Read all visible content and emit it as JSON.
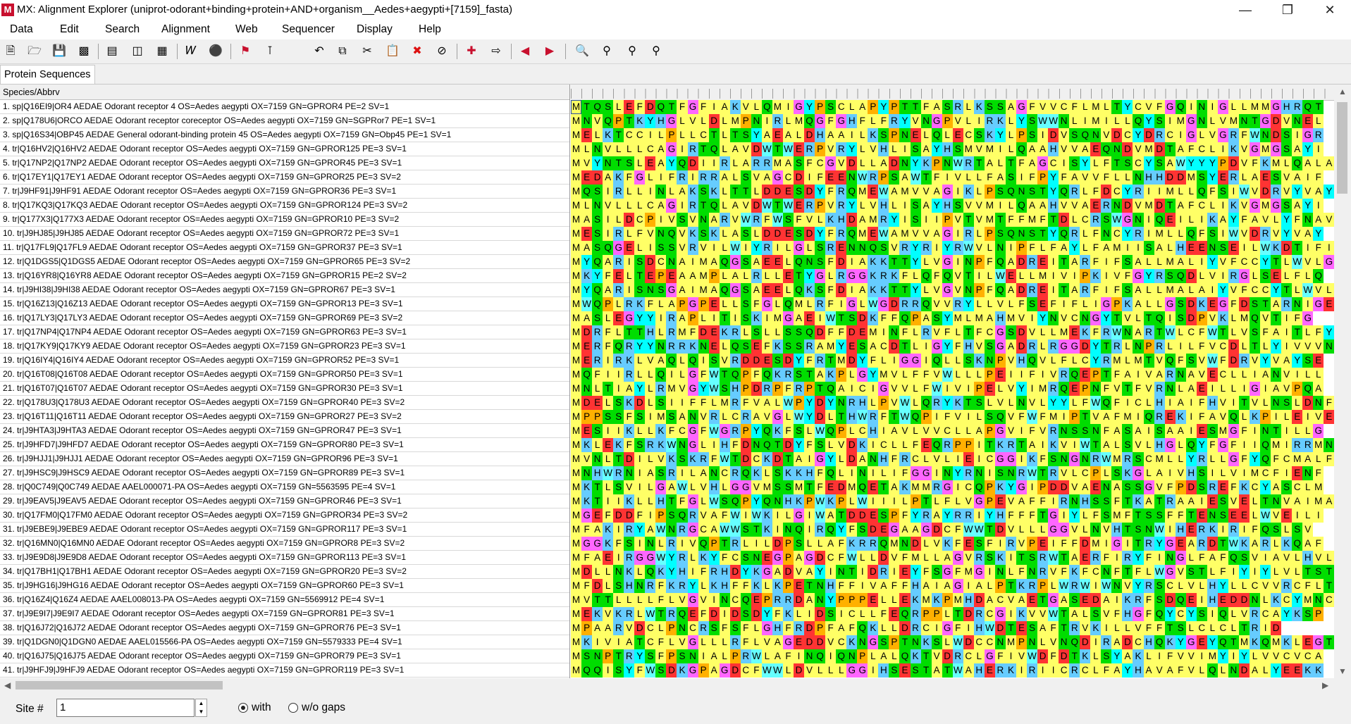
{
  "window": {
    "title": "MX: Alignment Explorer (uniprot-odorant+binding+protein+AND+organism__Aedes+aegypti+[7159]_fasta)",
    "icon_letter": "M"
  },
  "menu": [
    "Data",
    "Edit",
    "Search",
    "Alignment",
    "Web",
    "Sequencer",
    "Display",
    "Help"
  ],
  "toolbar_icons": [
    "new-file-icon",
    "open-folder-icon",
    "save-icon",
    "convert-icon",
    "sheet-icon",
    "columns-icon",
    "table-icon",
    "text-icon",
    "cut-tool-icon",
    "flag-icon",
    "mark-icon",
    "undo-icon",
    "copy-icon",
    "cut-icon",
    "paste-icon",
    "delete-icon",
    "delete-gaps-icon",
    "add-sequence-icon",
    "export-icon",
    "previous-icon",
    "next-icon",
    "search-zoom-icon",
    "find-previous-icon",
    "find-next-icon",
    "find-more-icon"
  ],
  "tabs": {
    "active": "Protein Sequences"
  },
  "grid": {
    "header_label": "Species/Abbrv",
    "color_scheme": {
      "A": "#ffff66",
      "G": "#ff66ff",
      "S": "#00dd00",
      "T": "#00dd00",
      "C": "#ffff66",
      "V": "#ffff66",
      "I": "#ffff66",
      "L": "#ffff66",
      "M": "#ffff66",
      "F": "#ffff66",
      "Y": "#00ffff",
      "W": "#66ffff",
      "N": "#00dd00",
      "Q": "#00dd00",
      "D": "#ff3333",
      "E": "#ff3333",
      "K": "#66ccff",
      "R": "#66ccff",
      "H": "#66ccff",
      "P": "#ffb000"
    },
    "rows": [
      {
        "name": "1. sp|Q16EI9|OR4 AEDAE Odorant receptor 4 OS=Aedes aegypti OX=7159 GN=GPROR4 PE=2 SV=1",
        "seq": "MTQSLEFDQTFGFIAKVLQMIGYPSCLAPYPTTFASRLKSSAGFVVCFLMLTYCVFGQINIGLLMMGHRQT"
      },
      {
        "name": "2. sp|Q178U6|ORCO AEDAE Odorant receptor coreceptor OS=Aedes aegypti OX=7159 GN=SGPRor7 PE=1 SV=1",
        "seq": "MNVQPTKYHGLVLDLMPNIRLMQGFGHFLFRYVNGPVLIRKLYSWWNLIMILLQYSIMGNLVMNTGDVNEL"
      },
      {
        "name": "3. sp|Q16S34|OBP45 AEDAE General odorant-binding protein 45 OS=Aedes aegypti OX=7159 GN=Obp45 PE=1 SV=1",
        "seq": "MELKTCCILPLLCTLTSYAEALDHAAILKSPNELQLECSKYLPSIDVSQNVDCYDRCIGLVGRFWNDSIGR"
      },
      {
        "name": "4. tr|Q16HV2|Q16HV2 AEDAE Odorant receptor OS=Aedes aegypti OX=7159 GN=GPROR125 PE=3 SV=1",
        "seq": "MLNVLLLCAGIRTQLAVDWTWERPVRYLVHLISAYHSMVMILQAAHVVAEQNDVMDTAFCLIKVGMGSAYI"
      },
      {
        "name": "5. tr|Q17NP2|Q17NP2 AEDAE Odorant receptor OS=Aedes aegypti OX=7159 GN=GPROR45 PE=3 SV=1",
        "seq": "MVYNTSLEAYQDIIRLARRMASFCGVDLLADNYKPNWRTALTFAGCISYLFTSCYSAWYYYPDVFKMLQALA"
      },
      {
        "name": "6. tr|Q17EY1|Q17EY1 AEDAE Odorant receptor OS=Aedes aegypti OX=7159 GN=GPROR25 PE=3 SV=2",
        "seq": "MEDAKFGLIFRIRRALSVAGCDIFEENWRPSAWTFIVLLFASIFPYFAVVFLLNHHDDMSYERLAESVAIF"
      },
      {
        "name": "7. tr|J9HF91|J9HF91 AEDAE Odorant receptor OS=Aedes aegypti OX=7159 GN=GPROR36 PE=3 SV=1",
        "seq": "MQSIRLLINLAKSKLTTLDDESDYFRQMEWAMVVAGIKLPSQNSTYQRLFDCYRIIMLLQFSIWVDRVYVAY"
      },
      {
        "name": "8. tr|Q17KQ3|Q17KQ3 AEDAE Odorant receptor OS=Aedes aegypti OX=7159 GN=GPROR124 PE=3 SV=2",
        "seq": "MLNVLLLCAGIRTQLAVDWTWERPVRYLVHLISAYHSVVMILQAAHVVAERNDVMDTAFCLIKVGMGSAYI"
      },
      {
        "name": "9. tr|Q177X3|Q177X3 AEDAE Odorant receptor OS=Aedes aegypti OX=7159 GN=GPROR10 PE=3 SV=2",
        "seq": "MASILDCPIVSVNARVWRFWSFVLKHDAMRYISIIPVTVMTFFMFTDLCRSWGNIQEILIKAYFAVLYFNAV"
      },
      {
        "name": "10. tr|J9HJ85|J9HJ85 AEDAE Odorant receptor OS=Aedes aegypti OX=7159 GN=GPROR72 PE=3 SV=1",
        "seq": "MESIRLFVNQVKSKLASLDDESDYFRQMEWAMVVAGIRLPSQNSTYQRLFNCYRIMLLQFSIWVDRVYVAY"
      },
      {
        "name": "11. tr|Q17FL9|Q17FL9 AEDAE Odorant receptor OS=Aedes aegypti OX=7159 GN=GPROR37 PE=3 SV=1",
        "seq": "MASQGELISSVRVILWIYRILGLSRENNQSVRYRIYRWVLNIPFLFAYLFAMIISALHEENSEILWKDTIFI"
      },
      {
        "name": "12. tr|Q1DGS5|Q1DGS5 AEDAE Odorant receptor OS=Aedes aegypti OX=7159 GN=GPROR65 PE=3 SV=2",
        "seq": "MYQARISDCNAIMAQGSAEELQNSFDIAKKTTYLVGINPFQADREITARFIFSALLMALIYVFCCYTLWVLG"
      },
      {
        "name": "13. tr|Q16YR8|Q16YR8 AEDAE Odorant receptor OS=Aedes aegypti OX=7159 GN=GPROR15 PE=2 SV=2",
        "seq": "MKYFELTEPEAAMPLALRLLETYGLRGGKRKFLQFQVTILWELLMIVIPKIVFGYRSQDLVIRGLSELFLQ"
      },
      {
        "name": "14. tr|J9HI38|J9HI38 AEDAE Odorant receptor OS=Aedes aegypti OX=7159 GN=GPROR67 PE=3 SV=1",
        "seq": "MYQARISNSGAIMAQGSAEELQKSFDIAKKTTYLVGVNPFQADREITARFIFSALLMALAIYVFCCYTLWVLG"
      },
      {
        "name": "15. tr|Q16Z13|Q16Z13 AEDAE Odorant receptor OS=Aedes aegypti OX=7159 GN=GPROR13 PE=3 SV=1",
        "seq": "MWQPLRKFLAPGPELLSFGLQMLRFIGLWGDRRQVVRYLLVLFSEFIFLIGPKALLGSDKEGFDSTARNIGE"
      },
      {
        "name": "16. tr|Q17LY3|Q17LY3 AEDAE Odorant receptor OS=Aedes aegypti OX=7159 GN=GPROR69 PE=3 SV=2",
        "seq": "MASLEGYYIRAPLITISKIMGAEIWTSDKFFQPASYMLMAHMVIYNVCNGYTVLTQISDPVKLMQVTIFG"
      },
      {
        "name": "17. tr|Q17NP4|Q17NP4 AEDAE Odorant receptor OS=Aedes aegypti OX=7159 GN=GPROR63 PE=3 SV=1",
        "seq": "MDRFLTTHLRMFDEKRLSLLSSQDFFDEMINFLRVFLTFCGSDVLLMEKFRWNARTWLCFWTLVSFAITLFY"
      },
      {
        "name": "18. tr|Q17KY9|Q17KY9 AEDAE Odorant receptor OS=Aedes aegypti OX=7159 GN=GPROR23 PE=3 SV=1",
        "seq": "MERFQRYYNRRKNELQSEFKSSRAMYESACDTLIGYFHVSGADRLRGGDYTRLNPRLILFVCDLTLYIVVVNE"
      },
      {
        "name": "19. tr|Q16IY4|Q16IY4 AEDAE Odorant receptor OS=Aedes aegypti OX=7159 GN=GPROR52 PE=3 SV=1",
        "seq": "MERIRKLVAQLQISVRDDESDYFRTMDYFLIGGIQLLSKNPVHQVLFLCYRMLMTVQFSVWFDRVYVAYSE"
      },
      {
        "name": "20. tr|Q16T08|Q16T08 AEDAE Odorant receptor OS=Aedes aegypti OX=7159 GN=GPROR50 PE=3 SV=1",
        "seq": "MQFIIRLLQILGFWTQPFQKRSTAKPLGYMVLFFVWLLLPEIIFIVRQEPTFAIVARNAVECLLIANVILL"
      },
      {
        "name": "21. tr|Q16T07|Q16T07 AEDAE Odorant receptor OS=Aedes aegypti OX=7159 GN=GPROR30 PE=3 SV=1",
        "seq": "MNLTIAYLRMVGYWSHPDRPFRPTQAICIGVVLFWIVIPELVYIMRQEPNFVTFVRNLAEILLIGIAVPQA"
      },
      {
        "name": "22. tr|Q178U3|Q178U3 AEDAE Odorant receptor OS=Aedes aegypti OX=7159 GN=GPROR40 PE=3 SV=2",
        "seq": "MDELSKDLSIIFFLMRFVALWPYDYNRHLPVWLQRYKTSLVLNVLYYLFWQFICLHIAIFHVITVLNSLDNF"
      },
      {
        "name": "23. tr|Q16T11|Q16T11 AEDAE Odorant receptor OS=Aedes aegypti OX=7159 GN=GPROR27 PE=3 SV=2",
        "seq": "MPPSSFSIMSANVRLCRAVGLWYDLTHWRFTWQPIFVILSQVFWFMIPTVAFMIQREKIFAVQLKPILEIVE"
      },
      {
        "name": "24. tr|J9HTA3|J9HTA3 AEDAE Odorant receptor OS=Aedes aegypti OX=7159 GN=GPROR47 PE=3 SV=1",
        "seq": "MESIIKLLKFCGFWGRPYQKFSLWQPLCHIAVLVVCLLAPGVIFVRNSSNFASAISAAIESMGFINTILLG"
      },
      {
        "name": "25. tr|J9HFD7|J9HFD7 AEDAE Odorant receptor OS=Aedes aegypti OX=7159 GN=GPROR80 PE=3 SV=1",
        "seq": "MKLEKFSRKWNGLIHFDNQTDYFSLVDKICLLFEQRPPITKRTAIKVIWTALSVLHGLQYFGFIIQMIRRMN"
      },
      {
        "name": "26. tr|J9HJJ1|J9HJJ1 AEDAE Odorant receptor OS=Aedes aegypti OX=7159 GN=GPROR96 PE=3 SV=1",
        "seq": "MVNLTDILVKSKRFWTDCKDTAIGYLDANHFRCLVLIEICGGIKFSNGNRWMRSCMLLYRLLGFYQFCMALF"
      },
      {
        "name": "27. tr|J9HSC9|J9HSC9 AEDAE Odorant receptor OS=Aedes aegypti OX=7159 GN=GPROR89 PE=3 SV=1",
        "seq": "MNHWRNIASRILANCRQKLSKKHFQLINILIFGGINYRNISNRWTRVLCPLSKGLAIVHSILVIMCFIENF"
      },
      {
        "name": "28. tr|Q0C749|Q0C749 AEDAE AAEL000071-PA OS=Aedes aegypti OX=7159 GN=5563595 PE=4 SV=1",
        "seq": "MKTLSVILGAWLVHLGGVMSSMTFEDMQETAKMMRGICQPKYGIPDDVAENASSGVFPDSREFKCYASCLM"
      },
      {
        "name": "29. tr|J9EAV5|J9EAV5 AEDAE Odorant receptor OS=Aedes aegypti OX=7159 GN=GPROR46 PE=3 SV=1",
        "seq": "MKTIIKLLHTFGLWSQPYQNHKPWKPLWIIILPTLFLVGPEVAFFIRNHSSFTKATRAAIESVELTNVAIMA"
      },
      {
        "name": "30. tr|Q17FM0|Q17FM0 AEDAE Odorant receptor OS=Aedes aegypti OX=7159 GN=GPROR34 PE=3 SV=2",
        "seq": "MGEFDDFIPSQRVAFWIWKILGIWATDDESPFYRAYRRIYHFFFTGIYLFSMFTSSFFTENSEELWVEILI"
      },
      {
        "name": "31. tr|J9EBE9|J9EBE9 AEDAE Odorant receptor OS=Aedes aegypti OX=7159 GN=GPROR117 PE=3 SV=1",
        "seq": "MFAKIRYAWNRGCAWWSTKINQIRQYFSDEGAAGDCFWWTDVLLLGGVLNVHTSNWIHERKIRIFQSLSV"
      },
      {
        "name": "32. tr|Q16MN0|Q16MN0 AEDAE Odorant receptor OS=Aedes aegypti OX=7159 GN=GPROR8 PE=3 SV=2",
        "seq": "MGGKFSINLRIVQPTRLILDPSLLAFKRRQMNDLVKFESFIRVPEIFFDMIGITRYGEARDTWKARLKQAF"
      },
      {
        "name": "33. tr|J9E9D8|J9E9D8 AEDAE Odorant receptor OS=Aedes aegypti OX=7159 GN=GPROR113 PE=3 SV=1",
        "seq": "MFAEIRGGWYRLKYFCSNEGPAGDCFWLLDVFMLLAGVRSKITSRWTAERFIRYFINGLFAFQSVIAVLHVL"
      },
      {
        "name": "34. tr|Q17BH1|Q17BH1 AEDAE Odorant receptor OS=Aedes aegypti OX=7159 GN=GPROR20 PE=3 SV=2",
        "seq": "MDLLNKLQKYHIFRHDYKGADVAYINTIDRIEYFSGFMGINLFNRVFKFCNFTFLWGVSTLFIYIYLVLTST"
      },
      {
        "name": "35. tr|J9HG16|J9HG16 AEDAE Odorant receptor OS=Aedes aegypti OX=7159 GN=GPROR60 PE=3 SV=1",
        "seq": "MFDLSHNRFKRYLKHFFKLKPETNHFFIVAFFHAIAGIALPTKRPLWRWIWNVYRSCLVLHYLLCVVRCFLT"
      },
      {
        "name": "36. tr|Q16Z4|Q16Z4 AEDAE AAEL008013-PA OS=Aedes aegypti OX=7159 GN=5569912 PE=4 SV=1",
        "seq": "MVTTLLLLFLVGVINCQEPRRDANYPPPELLEKMKPMHDACVAETGASEDAIKRFSDQEIHEDDNLKCYMNC"
      },
      {
        "name": "37. tr|J9E9I7|J9E9I7 AEDAE Odorant receptor OS=Aedes aegypti OX=7159 GN=GPROR81 PE=3 SV=1",
        "seq": "MEKVKRLWTRQEFDIDSDYFKLIDSICLLFEQRPPLTDRCGIKVVWTALSVFHGFQYCYSIQLVRCAYKSP"
      },
      {
        "name": "38. tr|Q16J72|Q16J72 AEDAE Odorant receptor OS=Aedes aegypti OX=7159 GN=GPROR76 PE=3 SV=1",
        "seq": "MPAARVDCLPNCRSFSFLGHFRDPFAFQKLLDRCIGFIHWDTESAFTRVKILLVFFTSLCLCLTRID"
      },
      {
        "name": "39. tr|Q1DGN0|Q1DGN0 AEDAE AAEL015566-PA OS=Aedes aegypti OX=7159 GN=5579333 PE=4 SV=1",
        "seq": "MKIVIATCFLVGLLLRFLVAGEDDVCKNGSPTNKSLWDCCNMPNLVNQDIRADCHQKYGEYQTMKQMKLEGTP"
      },
      {
        "name": "40. tr|Q16J75|Q16J75 AEDAE Odorant receptor OS=Aedes aegypti OX=7159 GN=GPROR79 PE=3 SV=1",
        "seq": "MSNPTRYSFPSNIALPRWLAFINQIQNPLALQKTVDRCLGFIVWDFDTKLSYAKLIFVVIMYIYLVVCVCA"
      },
      {
        "name": "41. tr|J9HFJ9|J9HFJ9 AEDAE Odorant receptor OS=Aedes aegypti OX=7159 GN=GPROR119 PE=3 SV=1",
        "seq": "MQQISYFWSDKGPAGDCFWWLDVLLLGGIHSESTATWAHERKIRIICRCLFAYHAVAFVLQLNDALYEEKK"
      }
    ]
  },
  "footer": {
    "site_label": "Site #",
    "site_value": "1",
    "radio_with": "with",
    "radio_without": "w/o gaps"
  }
}
